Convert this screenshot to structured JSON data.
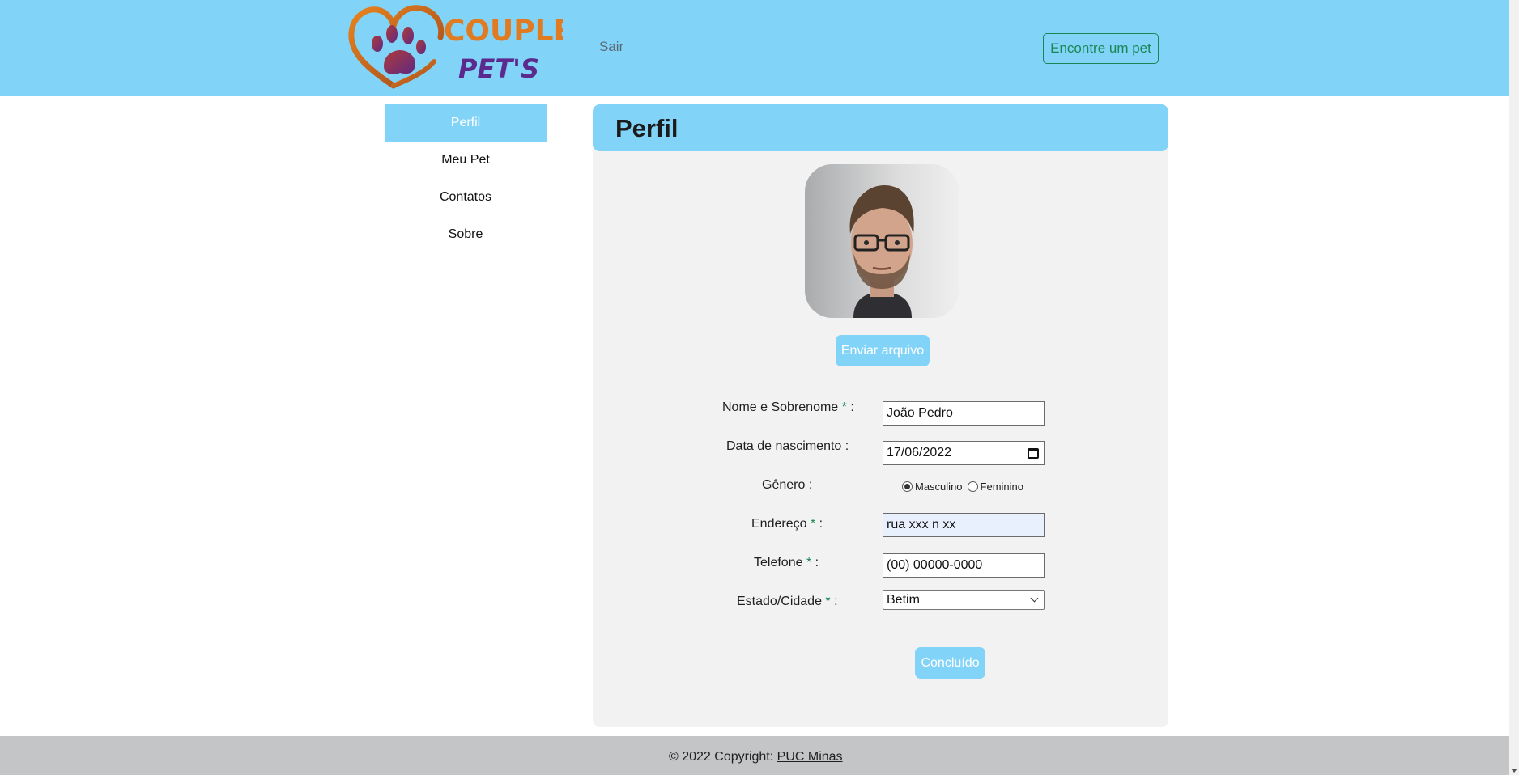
{
  "header": {
    "logo_text_top": "COUPLE",
    "logo_text_bottom": "PET'S",
    "logout_label": "Sair",
    "find_pet_label": "Encontre um pet"
  },
  "sidebar": {
    "items": [
      {
        "label": "Perfil",
        "active": true
      },
      {
        "label": "Meu Pet",
        "active": false
      },
      {
        "label": "Contatos",
        "active": false
      },
      {
        "label": "Sobre",
        "active": false
      }
    ]
  },
  "profile": {
    "title": "Perfil",
    "upload_label": "Enviar arquivo",
    "fields": {
      "name": {
        "label": "Nome e Sobrenome",
        "value": "João Pedro"
      },
      "birth": {
        "label": "Data de nascimento",
        "value": "17/06/2022"
      },
      "gender": {
        "label": "Gênero",
        "options": [
          "Masculino",
          "Feminino"
        ],
        "selected": "Masculino"
      },
      "address": {
        "label": "Endereço",
        "value": "rua xxx n xx"
      },
      "phone": {
        "label": "Telefone",
        "value": "(00) 00000-0000"
      },
      "city": {
        "label": "Estado/Cidade",
        "value": "Betim"
      }
    },
    "submit_label": "Concluído"
  },
  "footer": {
    "copyright": "© 2022 Copyright: ",
    "link_label": "PUC Minas"
  },
  "colors": {
    "brand_blue": "#81d3f8",
    "green": "#198754",
    "logo_orange": "#e07b22",
    "logo_purple": "#5b2a8c"
  }
}
